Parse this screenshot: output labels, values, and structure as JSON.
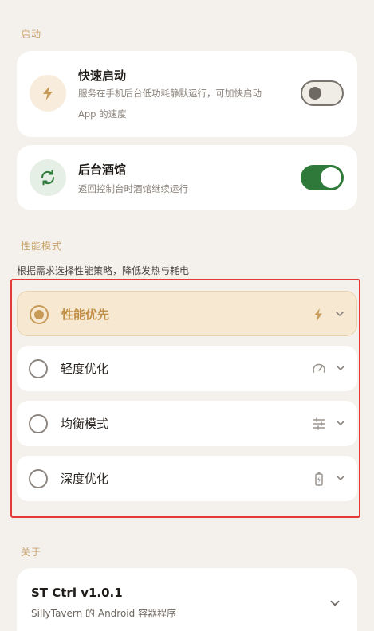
{
  "section_startup": "启动",
  "quick_start": {
    "title": "快速启动",
    "desc_line1": "服务在手机后台低功耗静默运行，可加快启动",
    "desc_line2": "App 的速度",
    "enabled": false
  },
  "background_tavern": {
    "title": "后台酒馆",
    "desc": "返回控制台时酒馆继续运行",
    "enabled": true
  },
  "section_performance": "性能模式",
  "performance_hint": "根据需求选择性能策略，降低发热与耗电",
  "modes": [
    {
      "label": "性能优先",
      "icon": "lightning-icon",
      "selected": true
    },
    {
      "label": "轻度优化",
      "icon": "speedometer-icon",
      "selected": false
    },
    {
      "label": "均衡模式",
      "icon": "sliders-icon",
      "selected": false
    },
    {
      "label": "深度优化",
      "icon": "battery-icon",
      "selected": false
    }
  ],
  "section_about": "关于",
  "about": {
    "title": "ST Ctrl v1.0.1",
    "desc": "SillyTavern 的 Android 容器程序"
  },
  "colors": {
    "accent": "#c79a58",
    "toggle_on": "#2f7a3a",
    "highlight": "#e53935"
  }
}
